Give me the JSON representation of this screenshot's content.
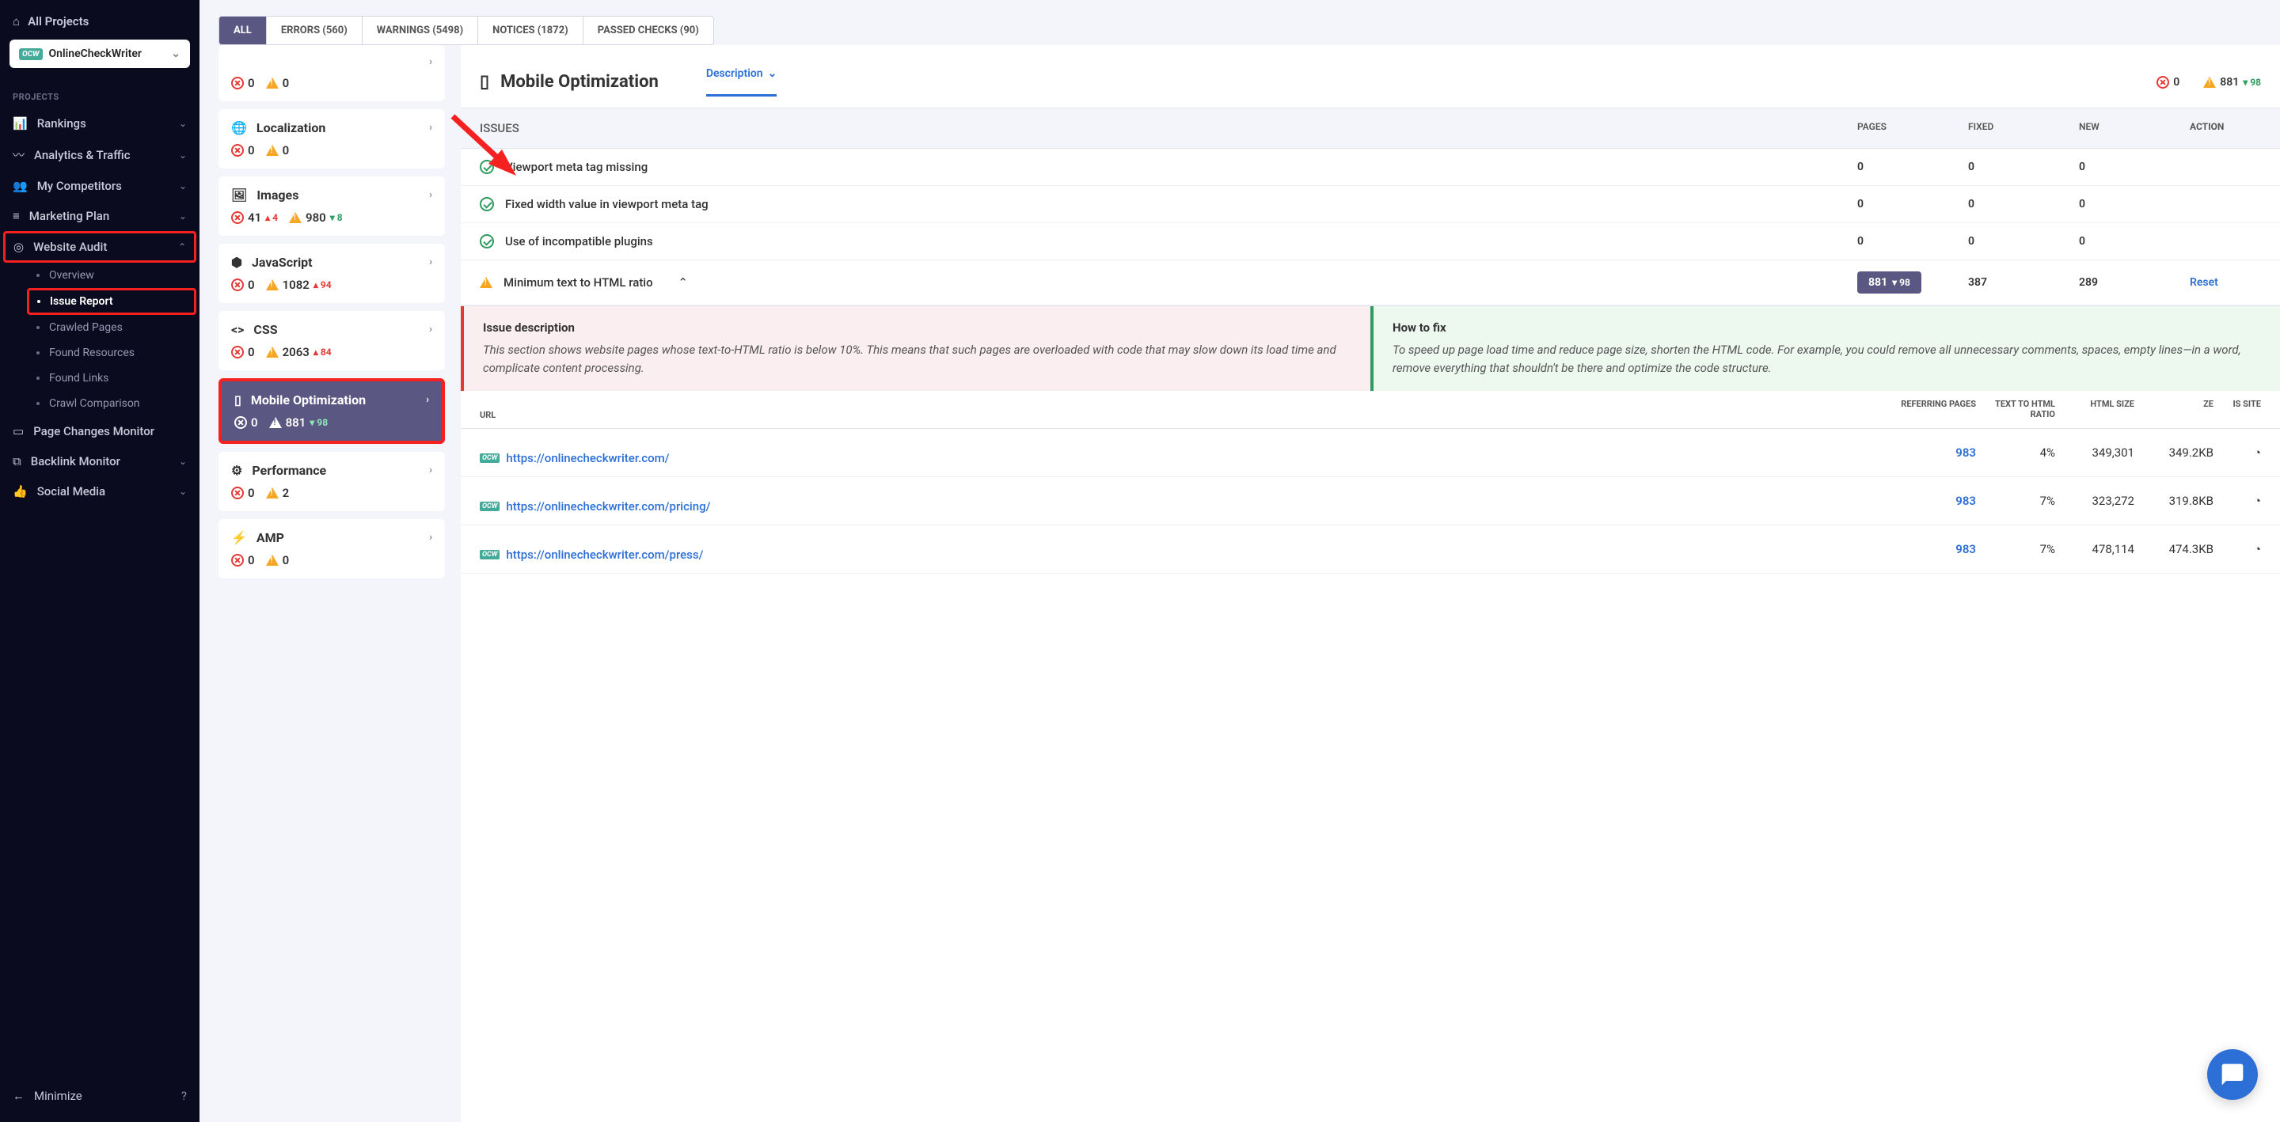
{
  "sidebar": {
    "all_projects": "All Projects",
    "current_project": "OnlineCheckWriter",
    "section_label": "PROJECTS",
    "nav": {
      "rankings": "Rankings",
      "analytics": "Analytics & Traffic",
      "competitors": "My Competitors",
      "marketing": "Marketing Plan",
      "audit": "Website Audit",
      "page_changes": "Page Changes Monitor",
      "backlink": "Backlink Monitor",
      "social": "Social Media",
      "minimize": "Minimize"
    },
    "audit_sub": {
      "overview": "Overview",
      "issue_report": "Issue Report",
      "crawled_pages": "Crawled Pages",
      "found_resources": "Found Resources",
      "found_links": "Found Links",
      "crawl_comparison": "Crawl Comparison"
    }
  },
  "filters": {
    "all": "ALL",
    "errors": "ERRORS (560)",
    "warnings": "WARNINGS (5498)",
    "notices": "NOTICES (1872)",
    "passed": "PASSED CHECKS (90)"
  },
  "categories": [
    {
      "name": "",
      "err": "0",
      "warn": "0"
    },
    {
      "name": "Localization",
      "err": "0",
      "warn": "0"
    },
    {
      "name": "Images",
      "err": "41",
      "err_delta": "▴ 4",
      "warn": "980",
      "warn_delta": "▾ 8"
    },
    {
      "name": "JavaScript",
      "err": "0",
      "warn": "1082",
      "warn_delta": "▴ 94"
    },
    {
      "name": "CSS",
      "err": "0",
      "warn": "2063",
      "warn_delta": "▴ 84"
    },
    {
      "name": "Mobile Optimization",
      "err": "0",
      "warn": "881",
      "warn_delta": "▾ 98"
    },
    {
      "name": "Performance",
      "err": "0",
      "warn": "2"
    },
    {
      "name": "AMP",
      "err": "0",
      "warn": "0"
    }
  ],
  "detail": {
    "title": "Mobile Optimization",
    "tab": "Description",
    "hdr_err": "0",
    "hdr_warn": "881",
    "hdr_warn_delta": "▾ 98",
    "columns": {
      "issues": "ISSUES",
      "pages": "PAGES",
      "fixed": "FIXED",
      "new": "NEW",
      "action": "ACTION"
    },
    "rows": [
      {
        "ok": true,
        "name": "Viewport meta tag missing",
        "pages": "0",
        "fixed": "0",
        "new": "0"
      },
      {
        "ok": true,
        "name": "Fixed width value in viewport meta tag",
        "pages": "0",
        "fixed": "0",
        "new": "0"
      },
      {
        "ok": true,
        "name": "Use of incompatible plugins",
        "pages": "0",
        "fixed": "0",
        "new": "0"
      },
      {
        "ok": false,
        "name": "Minimum text to HTML ratio",
        "pages": "881",
        "pages_delta": "▾ 98",
        "fixed": "387",
        "new": "289",
        "action": "Reset",
        "expanded": true
      }
    ],
    "desc": {
      "left_title": "Issue description",
      "left_text": "This section shows website pages whose text-to-HTML ratio is below 10%. This means that such pages are overloaded with code that may slow down its load time and complicate content processing.",
      "right_title": "How to fix",
      "right_text": "To speed up page load time and reduce page size, shorten the HTML code. For example, you could remove all unnecessary comments, spaces, empty lines—in a word, remove everything that shouldn't be there and optimize the code structure."
    },
    "url_cols": {
      "url": "URL",
      "ref": "REFERRING PAGES",
      "ratio": "TEXT TO HTML RATIO",
      "size": "HTML SIZE",
      "size2": "ZE",
      "site": "IS SITE"
    },
    "urls": [
      {
        "url": "https://onlinecheckwriter.com/",
        "ref": "983",
        "ratio": "4%",
        "size": "349,301",
        "size2": "349.2KB"
      },
      {
        "url": "https://onlinecheckwriter.com/pricing/",
        "ref": "983",
        "ratio": "7%",
        "size": "323,272",
        "size2": "319.8KB"
      },
      {
        "url": "https://onlinecheckwriter.com/press/",
        "ref": "983",
        "ratio": "7%",
        "size": "478,114",
        "size2": "474.3KB"
      }
    ]
  }
}
